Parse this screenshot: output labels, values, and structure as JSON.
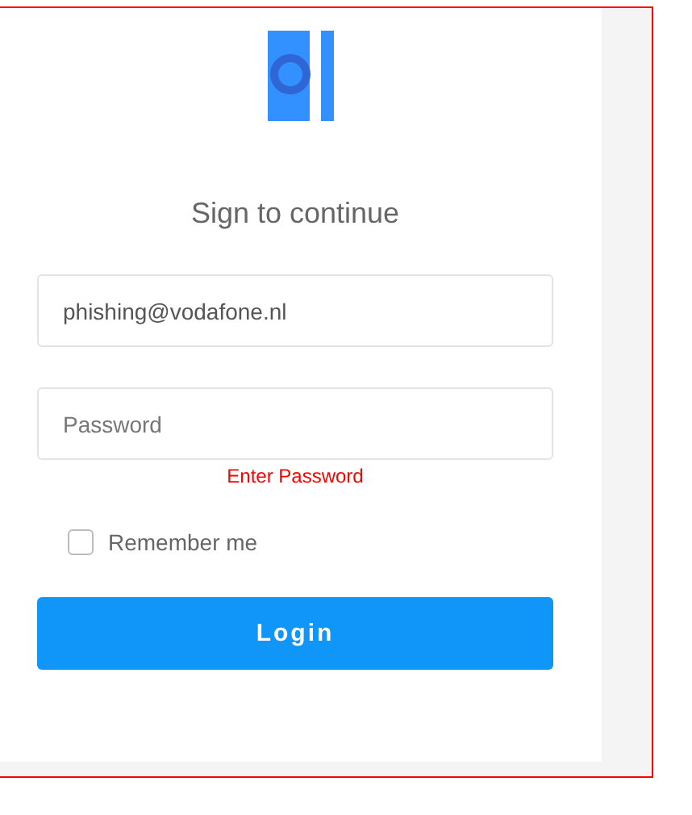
{
  "title": "Sign to continue",
  "email": {
    "value": "phishing@vodafone.nl"
  },
  "password": {
    "placeholder": "Password",
    "error": "Enter Password"
  },
  "remember": {
    "label": "Remember me",
    "checked": false
  },
  "login_button": {
    "label": "Login"
  }
}
